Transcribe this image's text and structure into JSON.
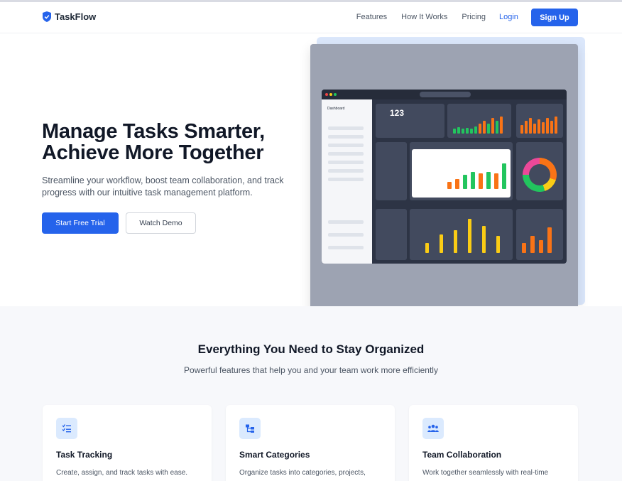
{
  "brand": {
    "name": "TaskFlow",
    "accent": "#2563eb"
  },
  "nav": {
    "links": [
      "Features",
      "How It Works",
      "Pricing"
    ],
    "login": "Login",
    "signup": "Sign Up"
  },
  "hero": {
    "title_line1": "Manage Tasks Smarter,",
    "title_line2": "Achieve More Together",
    "subtitle": "Streamline your workflow, boost team collaboration, and track progress with our intuitive task management platform.",
    "primary_cta": "Start Free Trial",
    "secondary_cta": "Watch Demo",
    "image": {
      "sidebar_title": "Dashboard",
      "stat_value": "123"
    }
  },
  "features": {
    "title": "Everything You Need to Stay Organized",
    "subtitle": "Powerful features that help you and your team work more efficiently",
    "cards": [
      {
        "icon": "checklist-icon",
        "title": "Task Tracking",
        "desc": "Create, assign, and track tasks with ease."
      },
      {
        "icon": "categories-icon",
        "title": "Smart Categories",
        "desc": "Organize tasks into categories, projects,"
      },
      {
        "icon": "team-icon",
        "title": "Team Collaboration",
        "desc": "Work together seamlessly with real-time"
      }
    ]
  }
}
